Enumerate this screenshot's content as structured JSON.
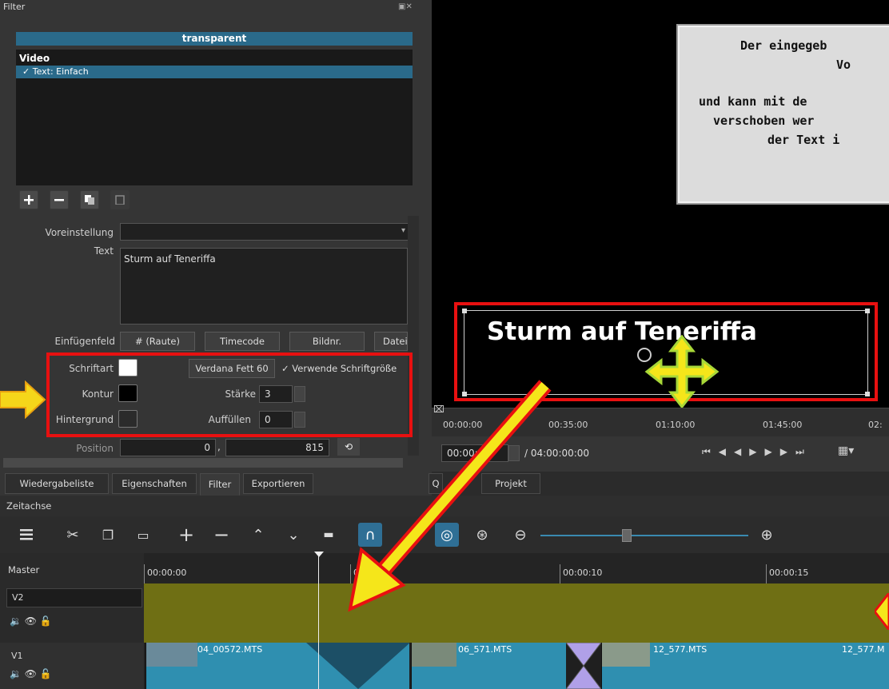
{
  "filter_panel": {
    "title": "Filter",
    "clip_name": "transparent",
    "section_label": "Video",
    "filters": [
      {
        "label": "✓ Text: Einfach"
      }
    ],
    "preset_label": "Voreinstellung",
    "preset_value": "",
    "text_label": "Text",
    "text_value": "Sturm auf Teneriffa",
    "insert_label": "Einfügenfeld",
    "insert_buttons": [
      "# (Raute)",
      "Timecode",
      "Bildnr.",
      "Datei"
    ],
    "font_label": "Schriftart",
    "font_button": "Verdana Fett 60",
    "use_font_size": "✓ Verwende Schriftgröße",
    "outline_label": "Kontur",
    "thickness_label": "Stärke",
    "thickness_value": "3",
    "background_label": "Hintergrund",
    "padding_label": "Auffüllen",
    "padding_value": "0",
    "position_label": "Position",
    "position_x": "0",
    "position_sep": ",",
    "position_y": "815"
  },
  "panel_tabs": [
    "Wiedergabeliste",
    "Eigenschaften",
    "Filter",
    "Exportieren"
  ],
  "preview": {
    "overlay_text": "Sturm auf Teneriffa",
    "note_lines": [
      "Der eingegeb",
      "Vo",
      "und kann mit de",
      "verschoben wer",
      "der Text i"
    ]
  },
  "ruler": {
    "ticks": [
      "00:00:00",
      "00:35:00",
      "01:10:00",
      "01:45:00",
      "02:"
    ]
  },
  "transport": {
    "timecode": "00:00:",
    "duration": "/ 04:00:00:00",
    "tabs": [
      "Q",
      "Projekt"
    ]
  },
  "timeline": {
    "title": "Zeitachse",
    "master_label": "Master",
    "tracks": [
      "V2",
      "V1"
    ],
    "ticks": [
      "00:00:00",
      "00:",
      "00:00:10",
      "00:00:15"
    ],
    "clips": [
      "04_00572.MTS",
      "06_571.MTS",
      "12_577.MTS",
      "12_577.M"
    ]
  },
  "colors": {
    "accent_blue": "#2a6a8a",
    "annotation_red": "#e81010",
    "arrow_yellow": "#f5e61a",
    "arrow_green": "#a8d838",
    "track_v2": "#6f6f14",
    "clip_blue": "#2f8fb0"
  }
}
